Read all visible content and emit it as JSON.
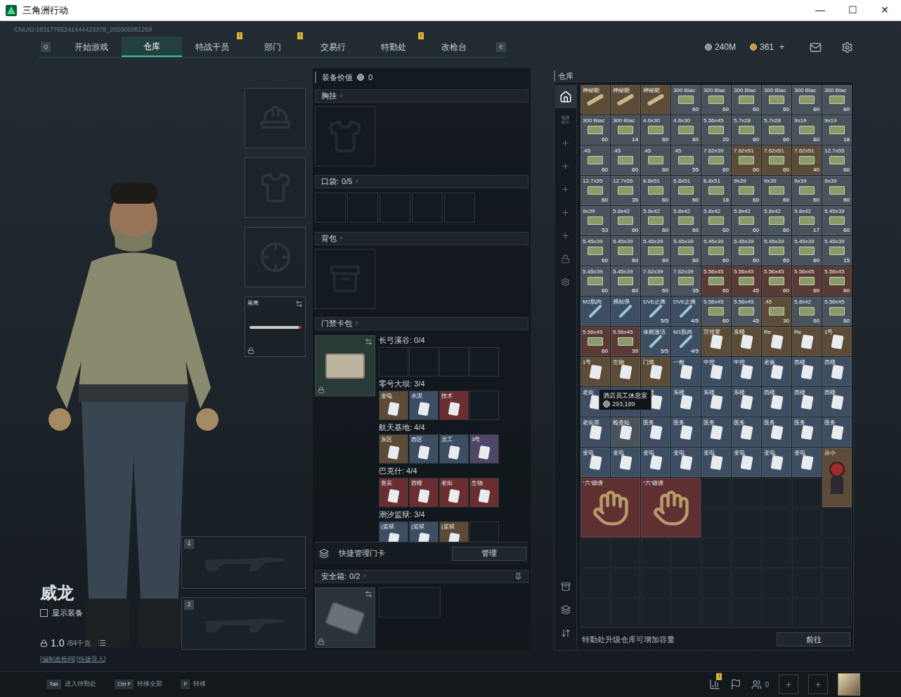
{
  "window": {
    "title": "三角洲行动",
    "controls": [
      "—",
      "☐",
      "✕"
    ]
  },
  "uid": "CNUID:18317765241444423378_202605051259",
  "nav": {
    "keys": [
      "Q",
      "E"
    ],
    "tabs": [
      {
        "label": "开始游戏",
        "selected": false,
        "badge": ""
      },
      {
        "label": "仓库",
        "selected": true,
        "badge": ""
      },
      {
        "label": "特战干员",
        "selected": false,
        "badge": "!"
      },
      {
        "label": "部门",
        "selected": false,
        "badge": "!"
      },
      {
        "label": "交易行",
        "selected": false,
        "badge": ""
      },
      {
        "label": "特勤处",
        "selected": false,
        "badge": "!"
      },
      {
        "label": "改枪台",
        "selected": false,
        "badge": ""
      }
    ]
  },
  "currency": {
    "money": "240M",
    "coins": "361",
    "add": "+"
  },
  "character": {
    "name": "威龙",
    "show_gear": {
      "label": "显示装备",
      "checked": false
    },
    "weight": "1.0",
    "capacity": "/84千克",
    "links": [
      "[编制改枪码]",
      "[快捷导入]"
    ]
  },
  "equipment": [
    {
      "kind": "helmet"
    },
    {
      "kind": "armor"
    },
    {
      "kind": "pistol"
    },
    {
      "kind": "knife",
      "label": "黑鹰",
      "locked": true
    }
  ],
  "weapons": [
    {
      "number": "1"
    },
    {
      "number": "2"
    }
  ],
  "loadout": {
    "value_label": "装备价值",
    "value": "0",
    "hint": "?",
    "chest": "胸挂",
    "pockets": {
      "label": "口袋:",
      "count": "0/5",
      "slots": [
        {
          "filled": false
        },
        {
          "filled": false
        },
        {
          "filled": false
        },
        {
          "filled": false
        },
        {
          "filled": false
        }
      ]
    },
    "backpack": "背包",
    "keycards": {
      "label": "门禁卡包",
      "locked": true,
      "groups": [
        {
          "label": "长弓溪谷: 0/4",
          "slots": [
            {
              "filled": false
            },
            {
              "filled": false
            },
            {
              "filled": false
            },
            {
              "filled": false
            }
          ]
        },
        {
          "label": "零号大坝: 3/4",
          "slots": [
            {
              "filled": true,
              "label": "变电",
              "color": "#5c4b36"
            },
            {
              "filled": true,
              "label": "水泥",
              "color": "#3d4e63"
            },
            {
              "filled": true,
              "label": "技术",
              "color": "#6a2e30"
            },
            {
              "filled": false
            }
          ]
        },
        {
          "label": "航天基地: 4/4",
          "slots": [
            {
              "filled": true,
              "label": "东区",
              "color": "#5c4b36"
            },
            {
              "filled": true,
              "label": "西区",
              "color": "#3d4e63"
            },
            {
              "filled": true,
              "label": "员工",
              "color": "#3d4e63"
            },
            {
              "filled": true,
              "label": "3号",
              "color": "#4f4566"
            }
          ]
        },
        {
          "label": "巴克什: 4/4",
          "slots": [
            {
              "filled": true,
              "label": "贵宾",
              "color": "#6a2e30"
            },
            {
              "filled": true,
              "label": "西楼",
              "color": "#6a2e30"
            },
            {
              "filled": true,
              "label": "老街",
              "color": "#6a2e30"
            },
            {
              "filled": true,
              "label": "生物",
              "color": "#6a2e30"
            }
          ]
        },
        {
          "label": "潮汐监狱: 3/4",
          "slots": [
            {
              "filled": true,
              "label": "(监狱",
              "color": "#3d4e63"
            },
            {
              "filled": true,
              "label": "(监狱",
              "color": "#3d4e63"
            },
            {
              "filled": true,
              "label": "(监狱",
              "color": "#5c4b36"
            },
            {
              "filled": false
            }
          ]
        }
      ]
    },
    "manage": {
      "label": "快捷管理门卡",
      "button": "管理"
    },
    "safe": {
      "label": "安全箱:",
      "count": "0/2",
      "locked": true,
      "slots": [
        {
          "filled": false
        },
        {
          "filled": false
        }
      ]
    }
  },
  "warehouse": {
    "title": "仓库",
    "side_tabs": [
      {
        "selected": true
      },
      {
        "selected": false
      },
      {
        "selected": false
      },
      {
        "selected": false
      },
      {
        "selected": false
      },
      {
        "selected": false
      },
      {
        "selected": false
      },
      {
        "selected": false
      },
      {
        "selected": false
      }
    ],
    "items": [
      {
        "label": "神秘能",
        "count": "",
        "kind": "tube",
        "color": "#5c4b36"
      },
      {
        "label": "神秘能",
        "count": "",
        "kind": "tube",
        "color": "#5c4b36"
      },
      {
        "label": "神秘能",
        "count": "",
        "kind": "tube",
        "color": "#5c4b36"
      },
      {
        "label": "300 Blac",
        "count": "60",
        "kind": "ammo",
        "color": "#4a535c"
      },
      {
        "label": "300 Blac",
        "count": "60",
        "kind": "ammo",
        "color": "#4a535c"
      },
      {
        "label": "300 Blac",
        "count": "60",
        "kind": "ammo",
        "color": "#4a535c"
      },
      {
        "label": "300 Blac",
        "count": "60",
        "kind": "ammo",
        "color": "#4a535c"
      },
      {
        "label": "300 Blac",
        "count": "60",
        "kind": "ammo",
        "color": "#4a535c"
      },
      {
        "label": "300 Blac",
        "count": "60",
        "kind": "ammo",
        "color": "#4a535c"
      },
      {
        "label": "300 Blac",
        "count": "60",
        "kind": "ammo",
        "color": "#4a535c"
      },
      {
        "label": "300 Blac",
        "count": "14",
        "kind": "ammo",
        "color": "#4a535c"
      },
      {
        "label": "4.6x30",
        "count": "60",
        "kind": "ammo",
        "color": "#4a535c"
      },
      {
        "label": "4.6x30",
        "count": "60",
        "kind": "ammo",
        "color": "#4a535c"
      },
      {
        "label": "5.56x45",
        "count": "20",
        "kind": "ammo",
        "color": "#4a535c"
      },
      {
        "label": "5.7x28",
        "count": "60",
        "kind": "ammo",
        "color": "#4a535c"
      },
      {
        "label": "5.7x28",
        "count": "60",
        "kind": "ammo",
        "color": "#4a535c"
      },
      {
        "label": "9x19",
        "count": "60",
        "kind": "ammo",
        "color": "#4a535c"
      },
      {
        "label": "9x19",
        "count": "18",
        "kind": "ammo",
        "color": "#4a535c"
      },
      {
        "label": ".45",
        "count": "60",
        "kind": "ammo",
        "color": "#4a535c"
      },
      {
        "label": ".45",
        "count": "60",
        "kind": "ammo",
        "color": "#4a535c"
      },
      {
        "label": ".45",
        "count": "60",
        "kind": "ammo",
        "color": "#4a535c"
      },
      {
        "label": ".45",
        "count": "55",
        "kind": "ammo",
        "color": "#4a535c"
      },
      {
        "label": "7.62x39",
        "count": "60",
        "kind": "ammo",
        "color": "#4a535c"
      },
      {
        "label": "7.62x51",
        "count": "60",
        "kind": "ammo",
        "color": "#5c4b36"
      },
      {
        "label": "7.62x51",
        "count": "60",
        "kind": "ammo",
        "color": "#5c4b36"
      },
      {
        "label": "7.62x51",
        "count": "40",
        "kind": "ammo",
        "color": "#5c4b36"
      },
      {
        "label": "12.7x55",
        "count": "60",
        "kind": "ammo",
        "color": "#4a535c"
      },
      {
        "label": "12.7x55",
        "count": "60",
        "kind": "ammo",
        "color": "#4a535c"
      },
      {
        "label": "12.7x55",
        "count": "35",
        "kind": "ammo",
        "color": "#4a535c"
      },
      {
        "label": "6.8x51",
        "count": "60",
        "kind": "ammo",
        "color": "#4a535c"
      },
      {
        "label": "6.8x51",
        "count": "60",
        "kind": "ammo",
        "color": "#4a535c"
      },
      {
        "label": "6.8x51",
        "count": "18",
        "kind": "ammo",
        "color": "#4a535c"
      },
      {
        "label": "9x39",
        "count": "60",
        "kind": "ammo",
        "color": "#4a535c"
      },
      {
        "label": "9x39",
        "count": "60",
        "kind": "ammo",
        "color": "#4a535c"
      },
      {
        "label": "9x39",
        "count": "60",
        "kind": "ammo",
        "color": "#4a535c"
      },
      {
        "label": "9x39",
        "count": "60",
        "kind": "ammo",
        "color": "#4a535c"
      },
      {
        "label": "9x39",
        "count": "53",
        "kind": "ammo",
        "color": "#4a535c"
      },
      {
        "label": "5.8x42",
        "count": "60",
        "kind": "ammo",
        "color": "#4a535c"
      },
      {
        "label": "5.8x42",
        "count": "60",
        "kind": "ammo",
        "color": "#4a535c"
      },
      {
        "label": "5.8x42",
        "count": "60",
        "kind": "ammo",
        "color": "#4a535c"
      },
      {
        "label": "5.8x42",
        "count": "60",
        "kind": "ammo",
        "color": "#4a535c"
      },
      {
        "label": "5.8x42",
        "count": "60",
        "kind": "ammo",
        "color": "#4a535c"
      },
      {
        "label": "5.8x42",
        "count": "60",
        "kind": "ammo",
        "color": "#4a535c"
      },
      {
        "label": "5.8x42",
        "count": "17",
        "kind": "ammo",
        "color": "#4a535c"
      },
      {
        "label": "5.45x39",
        "count": "60",
        "kind": "ammo",
        "color": "#4a535c"
      },
      {
        "label": "5.45x39",
        "count": "60",
        "kind": "ammo",
        "color": "#4a535c"
      },
      {
        "label": "5.45x39",
        "count": "60",
        "kind": "ammo",
        "color": "#4a535c"
      },
      {
        "label": "5.45x39",
        "count": "60",
        "kind": "ammo",
        "color": "#4a535c"
      },
      {
        "label": "5.45x39",
        "count": "60",
        "kind": "ammo",
        "color": "#4a535c"
      },
      {
        "label": "5.45x39",
        "count": "60",
        "kind": "ammo",
        "color": "#4a535c"
      },
      {
        "label": "5.45x39",
        "count": "60",
        "kind": "ammo",
        "color": "#4a535c"
      },
      {
        "label": "5.45x39",
        "count": "60",
        "kind": "ammo",
        "color": "#4a535c"
      },
      {
        "label": "5.45x39",
        "count": "60",
        "kind": "ammo",
        "color": "#4a535c"
      },
      {
        "label": "5.45x39",
        "count": "15",
        "kind": "ammo",
        "color": "#4a535c"
      },
      {
        "label": "5.45x39",
        "count": "60",
        "kind": "ammo",
        "color": "#4a535c"
      },
      {
        "label": "5.45x39",
        "count": "60",
        "kind": "ammo",
        "color": "#4a535c"
      },
      {
        "label": "7.62x39",
        "count": "60",
        "kind": "ammo",
        "color": "#4a535c"
      },
      {
        "label": "7.62x39",
        "count": "35",
        "kind": "ammo",
        "color": "#4a535c"
      },
      {
        "label": "5.56x45",
        "count": "60",
        "kind": "ammo",
        "color": "#5a3a34"
      },
      {
        "label": "5.56x45",
        "count": "45",
        "kind": "ammo",
        "color": "#5a3a34"
      },
      {
        "label": "5.56x45",
        "count": "60",
        "kind": "ammo",
        "color": "#5a3a34"
      },
      {
        "label": "5.56x45",
        "count": "60",
        "kind": "ammo",
        "color": "#5a3a34"
      },
      {
        "label": "5.56x45",
        "count": "60",
        "kind": "ammo",
        "color": "#5a3a34"
      },
      {
        "label": "M2肌肉",
        "count": "",
        "kind": "med",
        "color": "#3d4e63"
      },
      {
        "label": "感知弹",
        "count": "",
        "kind": "med",
        "color": "#3d4e63"
      },
      {
        "label": "DVE止痛",
        "count": "5/5",
        "kind": "med",
        "color": "#3d4e63"
      },
      {
        "label": "DVE止痛",
        "count": "4/5",
        "kind": "med",
        "color": "#3d4e63"
      },
      {
        "label": "5.56x45",
        "count": "60",
        "kind": "ammo",
        "color": "#4a535c"
      },
      {
        "label": "5.56x45",
        "count": "45",
        "kind": "ammo",
        "color": "#4a535c"
      },
      {
        "label": ".45",
        "count": "30",
        "kind": "ammo",
        "color": "#5c4b36"
      },
      {
        "label": "5.8x42",
        "count": "60",
        "kind": "ammo",
        "color": "#4a535c"
      },
      {
        "label": "5.56x45",
        "count": "60",
        "kind": "ammo",
        "color": "#4a535c"
      },
      {
        "label": "5.56x45",
        "count": "60",
        "kind": "ammo",
        "color": "#5a3a34"
      },
      {
        "label": "5.56x45",
        "count": "39",
        "kind": "ammo",
        "color": "#5a3a34"
      },
      {
        "label": "体能激活",
        "count": "5/5",
        "kind": "med",
        "color": "#3d4e63"
      },
      {
        "label": "M1肌肉",
        "count": "4/5",
        "kind": "med",
        "color": "#3d4e63"
      },
      {
        "label": "宣传室",
        "count": "",
        "kind": "key",
        "color": "#5c4b36"
      },
      {
        "label": "东楼",
        "count": "",
        "kind": "key",
        "color": "#5c4b36"
      },
      {
        "label": "Re",
        "count": "",
        "kind": "key",
        "color": "#5c4b36"
      },
      {
        "label": "Re",
        "count": "",
        "kind": "key",
        "color": "#5c4b36"
      },
      {
        "label": "1号",
        "count": "",
        "kind": "key",
        "color": "#5c4b36"
      },
      {
        "label": "1号",
        "count": "",
        "kind": "key",
        "color": "#5c4b36"
      },
      {
        "label": "生物",
        "count": "",
        "kind": "key",
        "color": "#5c4b36"
      },
      {
        "label": "门禁",
        "count": "",
        "kind": "key",
        "color": "#5c4b36"
      },
      {
        "label": "一般",
        "count": "",
        "kind": "key",
        "color": "#3d4e63"
      },
      {
        "label": "中控",
        "count": "",
        "kind": "key",
        "color": "#3d4e63"
      },
      {
        "label": "中控",
        "count": "",
        "kind": "key",
        "color": "#3d4e63"
      },
      {
        "label": "老板",
        "count": "",
        "kind": "key",
        "color": "#3d4e63"
      },
      {
        "label": "西楼",
        "count": "",
        "kind": "key",
        "color": "#3d4e63"
      },
      {
        "label": "西楼",
        "count": "",
        "kind": "key",
        "color": "#3d4e63"
      },
      {
        "label": "老街",
        "count": "",
        "kind": "key",
        "color": "#3d4e63"
      },
      {
        "label": "酒店",
        "count": "",
        "kind": "key",
        "color": "#3d4e63"
      },
      {
        "label": "主楼",
        "count": "",
        "kind": "key",
        "color": "#3d4e63"
      },
      {
        "label": "东楼",
        "count": "",
        "kind": "key",
        "color": "#3d4e63"
      },
      {
        "label": "东楼",
        "count": "",
        "kind": "key",
        "color": "#3d4e63"
      },
      {
        "label": "东楼",
        "count": "",
        "kind": "key",
        "color": "#3d4e63"
      },
      {
        "label": "西楼",
        "count": "",
        "kind": "key",
        "color": "#3d4e63"
      },
      {
        "label": "西楼",
        "count": "",
        "kind": "key",
        "color": "#3d4e63"
      },
      {
        "label": "西楼",
        "count": "",
        "kind": "key",
        "color": "#3d4e63"
      },
      {
        "label": "老街茶",
        "count": "",
        "kind": "key",
        "color": "#3d4e63"
      },
      {
        "label": "检查站",
        "count": "",
        "kind": "key",
        "color": "#4a535c"
      },
      {
        "label": "医务",
        "count": "",
        "kind": "key",
        "color": "#3d4e63"
      },
      {
        "label": "医务",
        "count": "",
        "kind": "key",
        "color": "#3d4e63"
      },
      {
        "label": "医务",
        "count": "",
        "kind": "key",
        "color": "#3d4e63"
      },
      {
        "label": "医务",
        "count": "",
        "kind": "key",
        "color": "#3d4e63"
      },
      {
        "label": "医务",
        "count": "",
        "kind": "key",
        "color": "#3d4e63"
      },
      {
        "label": "医务",
        "count": "",
        "kind": "key",
        "color": "#3d4e63"
      },
      {
        "label": "医务",
        "count": "",
        "kind": "key",
        "color": "#3d4e63"
      },
      {
        "label": "变电",
        "count": "",
        "kind": "key",
        "color": "#3d4e63"
      },
      {
        "label": "变电",
        "count": "",
        "kind": "key",
        "color": "#3d4e63"
      },
      {
        "label": "变电",
        "count": "",
        "kind": "key",
        "color": "#3d4e63"
      },
      {
        "label": "变电",
        "count": "",
        "kind": "key",
        "color": "#3d4e63"
      },
      {
        "label": "变电",
        "count": "",
        "kind": "key",
        "color": "#3d4e63"
      },
      {
        "label": "变电",
        "count": "",
        "kind": "key",
        "color": "#3d4e63"
      },
      {
        "label": "变电",
        "count": "",
        "kind": "key",
        "color": "#3d4e63"
      },
      {
        "label": "变电",
        "count": "",
        "kind": "key",
        "color": "#3d4e63"
      },
      {
        "label": "赤小",
        "count": "",
        "kind": "figure",
        "color": "#5c4b36"
      },
      {
        "label": "“六”级缠",
        "count": "",
        "kind": "big",
        "color": "#5e3032"
      },
      {
        "label": "“六”级缠",
        "count": "",
        "kind": "big",
        "color": "#5e3032"
      }
    ],
    "tooltip": {
      "title": "酒店员工休息室",
      "value": "293,199"
    },
    "footer": "特勤处升级仓库可增加容量",
    "footer_button": "前往"
  },
  "bottom_bar": {
    "hints": [
      {
        "key": "Tab",
        "label": "进入特勤处"
      },
      {
        "key": "Ctrl F",
        "label": "转移全部"
      },
      {
        "key": "F",
        "label": "转移"
      }
    ],
    "stats_badge": "!",
    "friends": "0",
    "add_slots": [
      "+",
      "+"
    ]
  }
}
